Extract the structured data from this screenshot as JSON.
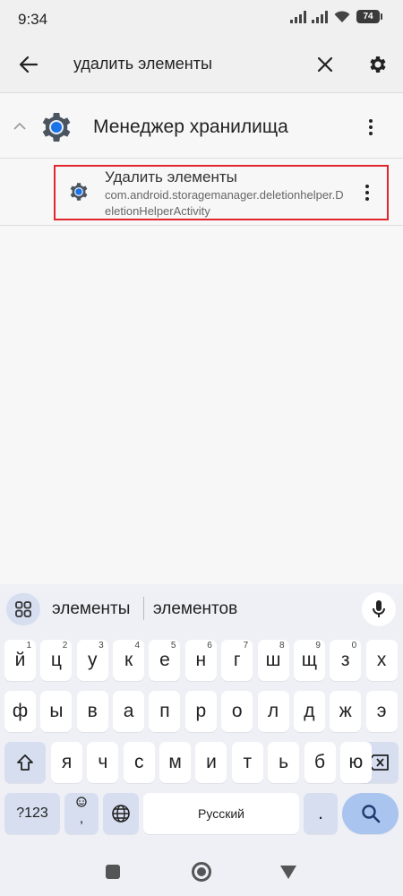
{
  "status_bar": {
    "time": "9:34",
    "battery": "74"
  },
  "search": {
    "query": "удалить элементы"
  },
  "results": {
    "group": {
      "title": "Менеджер хранилища"
    },
    "item": {
      "title": "Удалить элементы",
      "subtitle": "com.android.storagemanager.deletionhelper.DeletionHelperActivity"
    }
  },
  "keyboard": {
    "suggestions": [
      "элементы",
      "элементов"
    ],
    "row1": [
      {
        "label": "й",
        "num": "1"
      },
      {
        "label": "ц",
        "num": "2"
      },
      {
        "label": "у",
        "num": "3"
      },
      {
        "label": "к",
        "num": "4"
      },
      {
        "label": "е",
        "num": "5"
      },
      {
        "label": "н",
        "num": "6"
      },
      {
        "label": "г",
        "num": "7"
      },
      {
        "label": "ш",
        "num": "8"
      },
      {
        "label": "щ",
        "num": "9"
      },
      {
        "label": "з",
        "num": "0"
      },
      {
        "label": "х",
        "num": ""
      }
    ],
    "row2": [
      "ф",
      "ы",
      "в",
      "а",
      "п",
      "р",
      "о",
      "л",
      "д",
      "ж",
      "э"
    ],
    "row3": [
      "я",
      "ч",
      "с",
      "м",
      "и",
      "т",
      "ь",
      "б",
      "ю"
    ],
    "symbols_label": "?123",
    "comma_label": ",",
    "space_label": "Русский",
    "period_label": "."
  },
  "colors": {
    "highlight": "#e0262c",
    "accent": "#1a73e8",
    "keyboard_bg": "#eef0f6"
  }
}
